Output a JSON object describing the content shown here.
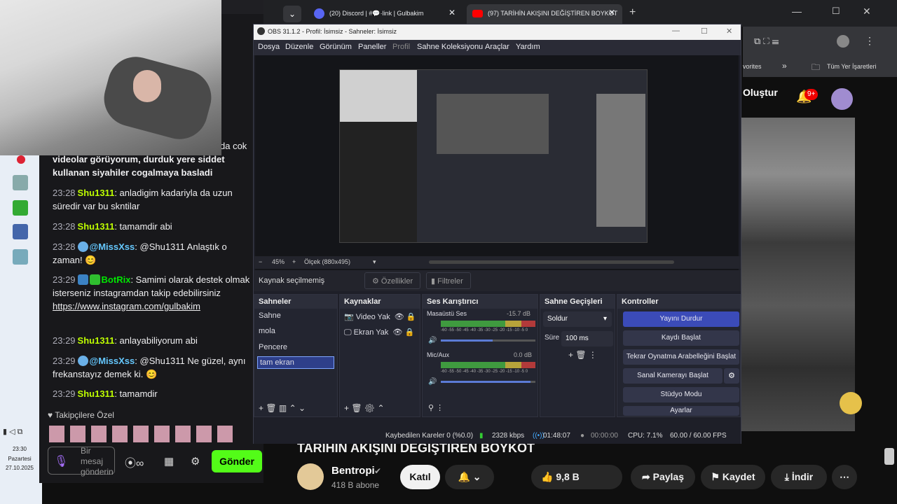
{
  "browser": {
    "tabs": [
      {
        "label": "(20) Discord | #💬·link | Gulbakim",
        "badge": "20"
      },
      {
        "label": "(97) TARİHİN AKIŞINI DEĞİŞTİREN BOYKOT"
      }
    ],
    "bookmarks": [
      "vorites",
      "Tüm Yer İşaretleri"
    ],
    "create_label": "Oluştur",
    "notif_count": "9+"
  },
  "chat": {
    "messages": [
      {
        "text": "videolar görüyorum, durduk yere siddet kullanan siyahiler cogalmaya basladi",
        "extra": "da cok"
      },
      {
        "time": "23:28",
        "user": "Shu1311",
        "text": "anladigim kadariyla da uzun süredir var bu skntilar",
        "color": "#bfff00"
      },
      {
        "time": "23:28",
        "user": "Shu1311",
        "text": "tamamdir abi",
        "color": "#bfff00"
      },
      {
        "time": "23:28",
        "user": "@MissXss",
        "text": "@Shu1311 Anlaştık o zaman! 😊",
        "color": "#65c8ff"
      },
      {
        "time": "23:29",
        "user": "BotRix",
        "text": "Samimi olarak destek olmak isterseniz instagramdan takip edebilirsiniz",
        "link": "https://www.instagram.com/gulbakim",
        "color": "#00e701"
      },
      {
        "time": "23:29",
        "user": "Shu1311",
        "text": "anlayabiliyorum abi",
        "color": "#bfff00"
      },
      {
        "time": "23:29",
        "user": "@MissXss",
        "text": "@Shu1311 Ne güzel, aynı frekanstayız demek ki. 😊",
        "color": "#65c8ff"
      },
      {
        "time": "23:29",
        "user": "Shu1311",
        "text": "tamamdir",
        "color": "#bfff00"
      }
    ],
    "followers_only": "Takipçilere Özel",
    "input_placeholder": "Bir mesaj gönderin",
    "send_label": "Gönder"
  },
  "taskbar": {
    "time": "23:30",
    "day": "Pazartesi",
    "date": "27.10.2025"
  },
  "obs": {
    "title": "OBS 31.1.2 - Profil: İsimsiz - Sahneler: İsimsiz",
    "menu": [
      "Dosya",
      "Düzenle",
      "Görünüm",
      "Paneller",
      "Profil",
      "Sahne Koleksiyonu",
      "Araçlar",
      "Yardım"
    ],
    "zoom": "45%",
    "scale": "Ölçek (880x495)",
    "no_source": "Kaynak seçilmemiş",
    "properties": "Özellikler",
    "filters": "Filtreler",
    "scenes_title": "Sahneler",
    "scenes": [
      "Sahne",
      "mola",
      "Pencere",
      "tam ekran"
    ],
    "sources_title": "Kaynaklar",
    "sources": [
      "Video Yak",
      "Ekran Yak"
    ],
    "mixer_title": "Ses Karıştırıcı",
    "mixer": [
      {
        "name": "Masaüstü Ses",
        "db": "-15.7 dB",
        "level": 0.55
      },
      {
        "name": "Mic/Aux",
        "db": "0.0 dB",
        "level": 0.95
      }
    ],
    "meter_scale": "-60 -55 -50 -45 -40 -35 -30 -25 -20 -15 -10 -5 0",
    "transitions_title": "Sahne Geçişleri",
    "transition": "Soldur",
    "duration_label": "Süre",
    "duration": "100 ms",
    "controls_title": "Kontroller",
    "controls": [
      "Yayını Durdur",
      "Kaydı Başlat",
      "Tekrar Oynatma Arabelleğini Başlat",
      "Sanal Kamerayı Başlat",
      "Stüdyo Modu",
      "Ayarlar"
    ],
    "status": {
      "dropped": "Kaybedilen Kareler 0 (%0.0)",
      "bitrate": "2328 kbps",
      "live_time": "01:48:07",
      "rec_time": "00:00:00",
      "cpu": "CPU: 7.1%",
      "fps": "60.00 / 60.00 FPS"
    }
  },
  "video": {
    "title": "TARİHİN AKIŞINI DEĞİŞTİREN BOYKOT",
    "channel": "Bentropi",
    "subs": "418 B abone",
    "join": "Katıl",
    "likes": "9,8 B",
    "share": "Paylaş",
    "save": "Kaydet",
    "download": "İndir"
  }
}
